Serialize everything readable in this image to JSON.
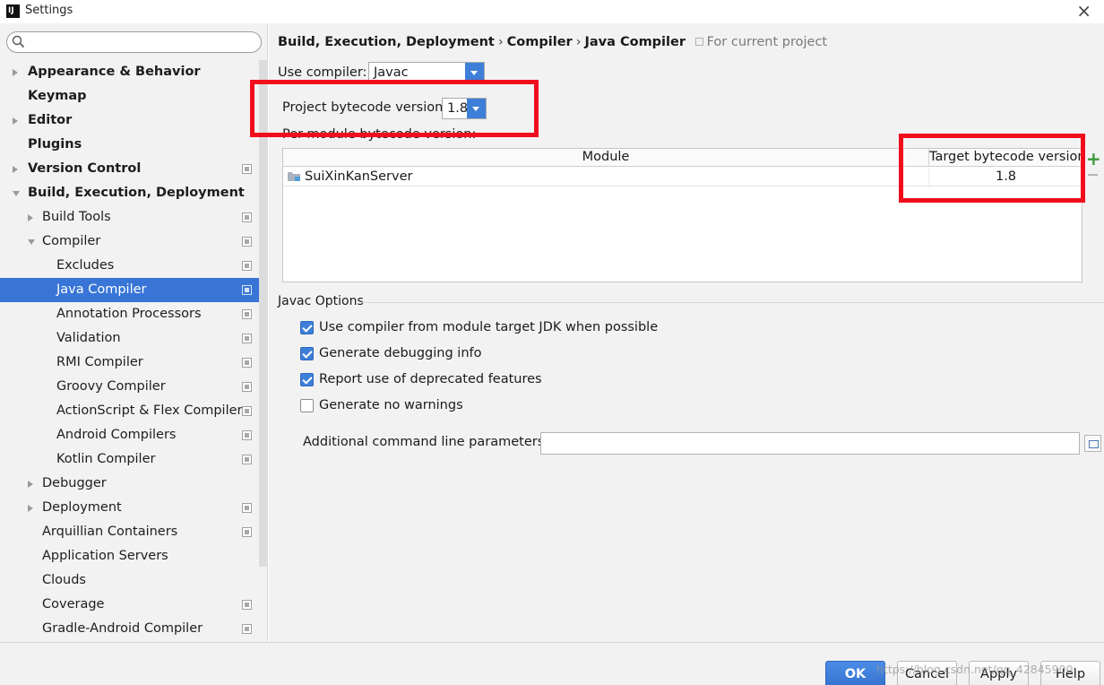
{
  "window": {
    "title": "Settings",
    "close_glyph": "×"
  },
  "search": {
    "placeholder": ""
  },
  "sidebar": {
    "items": [
      {
        "label": "Appearance & Behavior",
        "arrow": "right",
        "bold": true,
        "level": 0,
        "proj": false
      },
      {
        "label": "Keymap",
        "arrow": "",
        "bold": true,
        "level": 0,
        "proj": false
      },
      {
        "label": "Editor",
        "arrow": "right",
        "bold": true,
        "level": 0,
        "proj": false
      },
      {
        "label": "Plugins",
        "arrow": "",
        "bold": true,
        "level": 0,
        "proj": false
      },
      {
        "label": "Version Control",
        "arrow": "right",
        "bold": true,
        "level": 0,
        "proj": true
      },
      {
        "label": "Build, Execution, Deployment",
        "arrow": "down",
        "bold": true,
        "level": 0,
        "proj": false
      },
      {
        "label": "Build Tools",
        "arrow": "right",
        "bold": false,
        "level": 1,
        "proj": true
      },
      {
        "label": "Compiler",
        "arrow": "down",
        "bold": false,
        "level": 1,
        "proj": true
      },
      {
        "label": "Excludes",
        "arrow": "",
        "bold": false,
        "level": 2,
        "proj": true
      },
      {
        "label": "Java Compiler",
        "arrow": "",
        "bold": false,
        "level": 2,
        "proj": true,
        "selected": true
      },
      {
        "label": "Annotation Processors",
        "arrow": "",
        "bold": false,
        "level": 2,
        "proj": true
      },
      {
        "label": "Validation",
        "arrow": "",
        "bold": false,
        "level": 2,
        "proj": true
      },
      {
        "label": "RMI Compiler",
        "arrow": "",
        "bold": false,
        "level": 2,
        "proj": true
      },
      {
        "label": "Groovy Compiler",
        "arrow": "",
        "bold": false,
        "level": 2,
        "proj": true
      },
      {
        "label": "ActionScript & Flex Compiler",
        "arrow": "",
        "bold": false,
        "level": 2,
        "proj": true
      },
      {
        "label": "Android Compilers",
        "arrow": "",
        "bold": false,
        "level": 2,
        "proj": true
      },
      {
        "label": "Kotlin Compiler",
        "arrow": "",
        "bold": false,
        "level": 2,
        "proj": true
      },
      {
        "label": "Debugger",
        "arrow": "right",
        "bold": false,
        "level": 1,
        "proj": false
      },
      {
        "label": "Deployment",
        "arrow": "right",
        "bold": false,
        "level": 1,
        "proj": true
      },
      {
        "label": "Arquillian Containers",
        "arrow": "",
        "bold": false,
        "level": 1,
        "proj": true
      },
      {
        "label": "Application Servers",
        "arrow": "",
        "bold": false,
        "level": 1,
        "proj": false
      },
      {
        "label": "Clouds",
        "arrow": "",
        "bold": false,
        "level": 1,
        "proj": false
      },
      {
        "label": "Coverage",
        "arrow": "",
        "bold": false,
        "level": 1,
        "proj": true
      },
      {
        "label": "Gradle-Android Compiler",
        "arrow": "",
        "bold": false,
        "level": 1,
        "proj": true
      }
    ]
  },
  "breadcrumb": {
    "parts": [
      "Build, Execution, Deployment",
      "Compiler",
      "Java Compiler"
    ],
    "separator": "›",
    "scope": "For current project"
  },
  "compiler": {
    "use_compiler_label": "Use compiler:",
    "use_compiler_value": "Javac",
    "project_bytecode_label": "Project bytecode version:",
    "project_bytecode_value": "1.8",
    "per_module_label": "Per-module bytecode version:"
  },
  "module_table": {
    "columns": [
      "Module",
      "Target bytecode version"
    ],
    "rows": [
      {
        "module": "SuiXinKanServer",
        "target": "1.8"
      }
    ]
  },
  "javac_options": {
    "group_title": "Javac Options",
    "checkboxes": [
      {
        "label": "Use compiler from module target JDK when possible",
        "checked": true
      },
      {
        "label": "Generate debugging info",
        "checked": true
      },
      {
        "label": "Report use of deprecated features",
        "checked": true
      },
      {
        "label": "Generate no warnings",
        "checked": false
      }
    ],
    "params_label": "Additional command line parameters:",
    "params_value": ""
  },
  "buttons": {
    "ok": "OK",
    "cancel": "Cancel",
    "apply": "Apply",
    "help": "Help"
  },
  "watermark": "https://blog.csdn.net/qq_42845900",
  "colors": {
    "accent": "#3875d7",
    "highlight_box": "#f20d1c",
    "add_green": "#3a9a3a"
  }
}
